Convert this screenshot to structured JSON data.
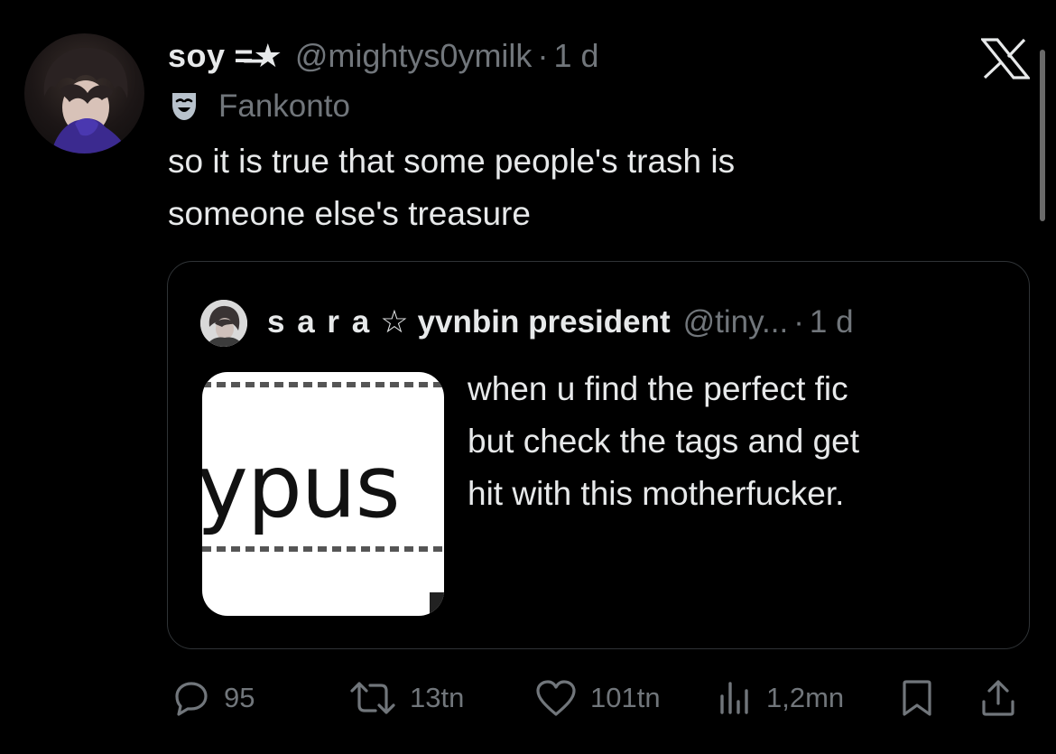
{
  "tweet": {
    "display_name": "soy",
    "name_decoration": "=̶★",
    "handle": "@mightys0ymilk",
    "separator": "·",
    "time": "1 d",
    "community": "Fankonto",
    "text_lines": [
      "so it is true that some people's trash is",
      "someone else's treasure"
    ]
  },
  "quote": {
    "display_name": "s a r a",
    "star": "☆",
    "display_name_2": "yvnbin president",
    "handle": "@tiny...",
    "separator": "·",
    "time": "1 d",
    "media_text": "ypus",
    "text_lines": [
      "when u find the perfect fic",
      "but check the tags and get",
      "hit with this motherfucker."
    ]
  },
  "actions": {
    "replies": "95",
    "reposts": "13tn",
    "likes": "101tn",
    "views": "1,2mn"
  },
  "icons": {
    "close": "x-logo-icon",
    "community": "community-mask-icon",
    "reply": "reply-icon",
    "repost": "repost-icon",
    "like": "heart-icon",
    "views": "views-bar-chart-icon",
    "bookmark": "bookmark-icon",
    "share": "share-icon"
  },
  "colors": {
    "background": "#000000",
    "text_primary": "#e7e9ea",
    "text_secondary": "#71767b",
    "border": "#2f3336",
    "community_icon": "#b8c2cc"
  }
}
